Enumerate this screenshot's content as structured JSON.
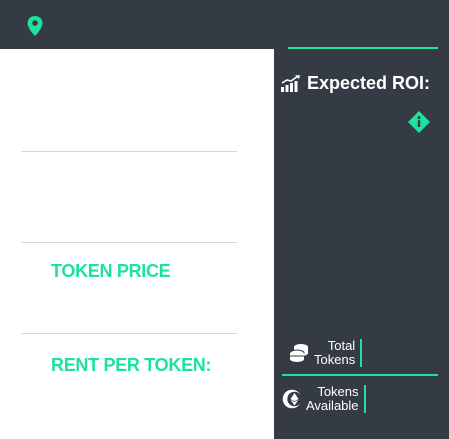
{
  "main": {
    "token_price_label": "TOKEN PRICE",
    "rent_per_token_label": "RENT PER TOKEN:"
  },
  "sidebar": {
    "roi_title": "Expected ROI:",
    "total_tokens": [
      "Total",
      "Tokens"
    ],
    "tokens_available": [
      "Tokens",
      "Available"
    ]
  },
  "colors": {
    "accent": "#1de29c",
    "dark_panel": "#353b45",
    "divider": "#d4d7dc"
  },
  "icons": [
    "map-pin-icon",
    "bar-chart-icon",
    "info-diamond-icon",
    "coin-stack-icon",
    "ethereum-coin-icon"
  ]
}
